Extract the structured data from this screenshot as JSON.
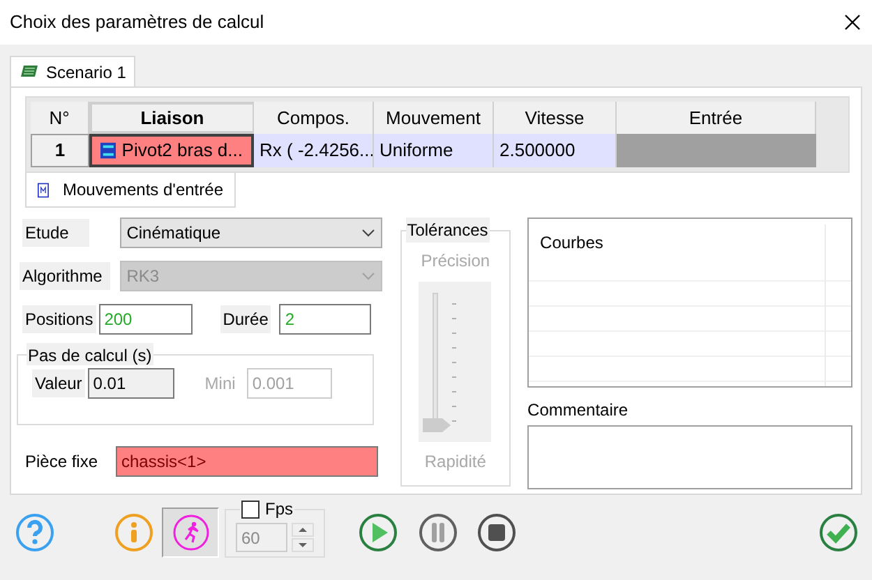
{
  "window": {
    "title": "Choix des paramètres de calcul"
  },
  "tabs": [
    {
      "label": "Scenario 1",
      "selected": true
    }
  ],
  "table": {
    "columns": [
      "N°",
      "Liaison",
      "Compos.",
      "Mouvement",
      "Vitesse",
      "Entrée"
    ],
    "rows": [
      {
        "number": "1",
        "liaison": "Pivot2 bras d...",
        "compos": "Rx ( -2.4256...",
        "mouvement": "Uniforme",
        "vitesse": "2.500000"
      }
    ]
  },
  "subtab": {
    "label": "Mouvements d'entrée"
  },
  "etude": {
    "label": "Etude",
    "value": "Cinématique",
    "disabled": false
  },
  "algorithme": {
    "label": "Algorithme",
    "value": "RK3",
    "disabled": true
  },
  "positions": {
    "label": "Positions",
    "value": "200"
  },
  "duree": {
    "label": "Durée",
    "value": "2"
  },
  "pas_de_calcul": {
    "title": "Pas de calcul (s)",
    "valeur": {
      "label": "Valeur",
      "value": "0.01",
      "disabled": false
    },
    "mini": {
      "label": "Mini",
      "value": "0.001",
      "disabled": true
    }
  },
  "piece_fixe": {
    "label": "Pièce fixe",
    "value": "chassis<1>"
  },
  "tolerances": {
    "title": "Tolérances",
    "top_label": "Précision",
    "bottom_label": "Rapidité",
    "level": 0,
    "disabled": true
  },
  "courbes": {
    "label": "Courbes"
  },
  "commentaire": {
    "label": "Commentaire"
  },
  "toolbar": [
    {
      "kind": "help"
    },
    {
      "kind": "info"
    },
    {
      "kind": "motion",
      "selected": true
    },
    {
      "kind": "fps",
      "label": "Fps",
      "checked": false,
      "value": "60",
      "disabled": true
    },
    {
      "kind": "play"
    },
    {
      "kind": "pause"
    },
    {
      "kind": "stop"
    },
    {
      "kind": "ok"
    }
  ]
}
